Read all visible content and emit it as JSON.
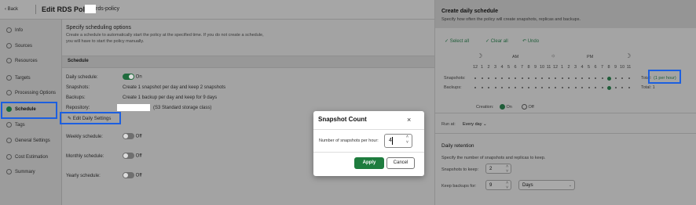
{
  "header": {
    "back_label": "Back",
    "title": "Edit RDS Policy",
    "policy_name_suffix": "rds-policy"
  },
  "nav": {
    "items": [
      {
        "label": "Info"
      },
      {
        "label": "Sources"
      },
      {
        "label": "Resources"
      },
      {
        "label": "Targets"
      },
      {
        "label": "Processing Options"
      },
      {
        "label": "Schedule",
        "active": true
      },
      {
        "label": "Tags"
      },
      {
        "label": "General Settings"
      },
      {
        "label": "Cost Estimation"
      },
      {
        "label": "Summary"
      }
    ]
  },
  "main": {
    "title": "Specify scheduling options",
    "desc1": "Create a schedule to automatically start the policy at the specified time. If you do not create a schedule,",
    "desc2": "you will have to start the policy manually.",
    "schedule_header": "Schedule",
    "daily_label": "Daily schedule:",
    "daily_state": "On",
    "snapshots_label": "Snapshots:",
    "snapshots_value": "Create 1 snapshot per day and keep 2 snapshots",
    "backups_label": "Backups:",
    "backups_value": "Create 1 backup per day and keep for 9 days",
    "repository_label": "Repository:",
    "repository_value": "(S3 Standard storage class)",
    "edit_daily_label": "Edit Daily Settings",
    "weekly_label": "Weekly schedule:",
    "weekly_state": "Off",
    "monthly_label": "Monthly schedule:",
    "monthly_state": "Off",
    "yearly_label": "Yearly schedule:",
    "yearly_state": "Off"
  },
  "modal": {
    "title": "Snapshot Count",
    "close_icon": "×",
    "field_label": "Number of snapshots per hour:",
    "field_value": "4",
    "apply_label": "Apply",
    "cancel_label": "Cancel"
  },
  "panel": {
    "title": "Create daily schedule",
    "subtitle": "Specify how often the policy will create snapshots, replicas and backups.",
    "select_all": "Select all",
    "clear_all": "Clear all",
    "undo": "Undo",
    "am": "AM",
    "pm": "PM",
    "hours": [
      "12",
      "1",
      "2",
      "3",
      "4",
      "5",
      "6",
      "7",
      "8",
      "9",
      "10",
      "11",
      "12",
      "1",
      "2",
      "3",
      "4",
      "5",
      "6",
      "7",
      "8",
      "9",
      "10",
      "11"
    ],
    "snapshots_row": "Snapshots:",
    "backups_row": "Backups:",
    "total_snap": "Total:",
    "per_hour": "(1 per hour)",
    "total_backup": "Total: 1",
    "creation_label": "Creation:",
    "creation_on": "On",
    "creation_off": "Off",
    "run_at_label": "Run at:",
    "run_at_value": "Every day",
    "retention_title": "Daily retention",
    "retention_desc": "Specify the number of snapshots and replicas to keep.",
    "snap_keep_label": "Snapshots to keep:",
    "snap_keep_value": "2",
    "backup_keep_label": "Keep backups for:",
    "backup_keep_value": "9",
    "backup_unit": "Days"
  },
  "colors": {
    "accent": "#1e7c3e",
    "highlight": "#1c5fe0",
    "overlay": "#9a9a9a"
  }
}
